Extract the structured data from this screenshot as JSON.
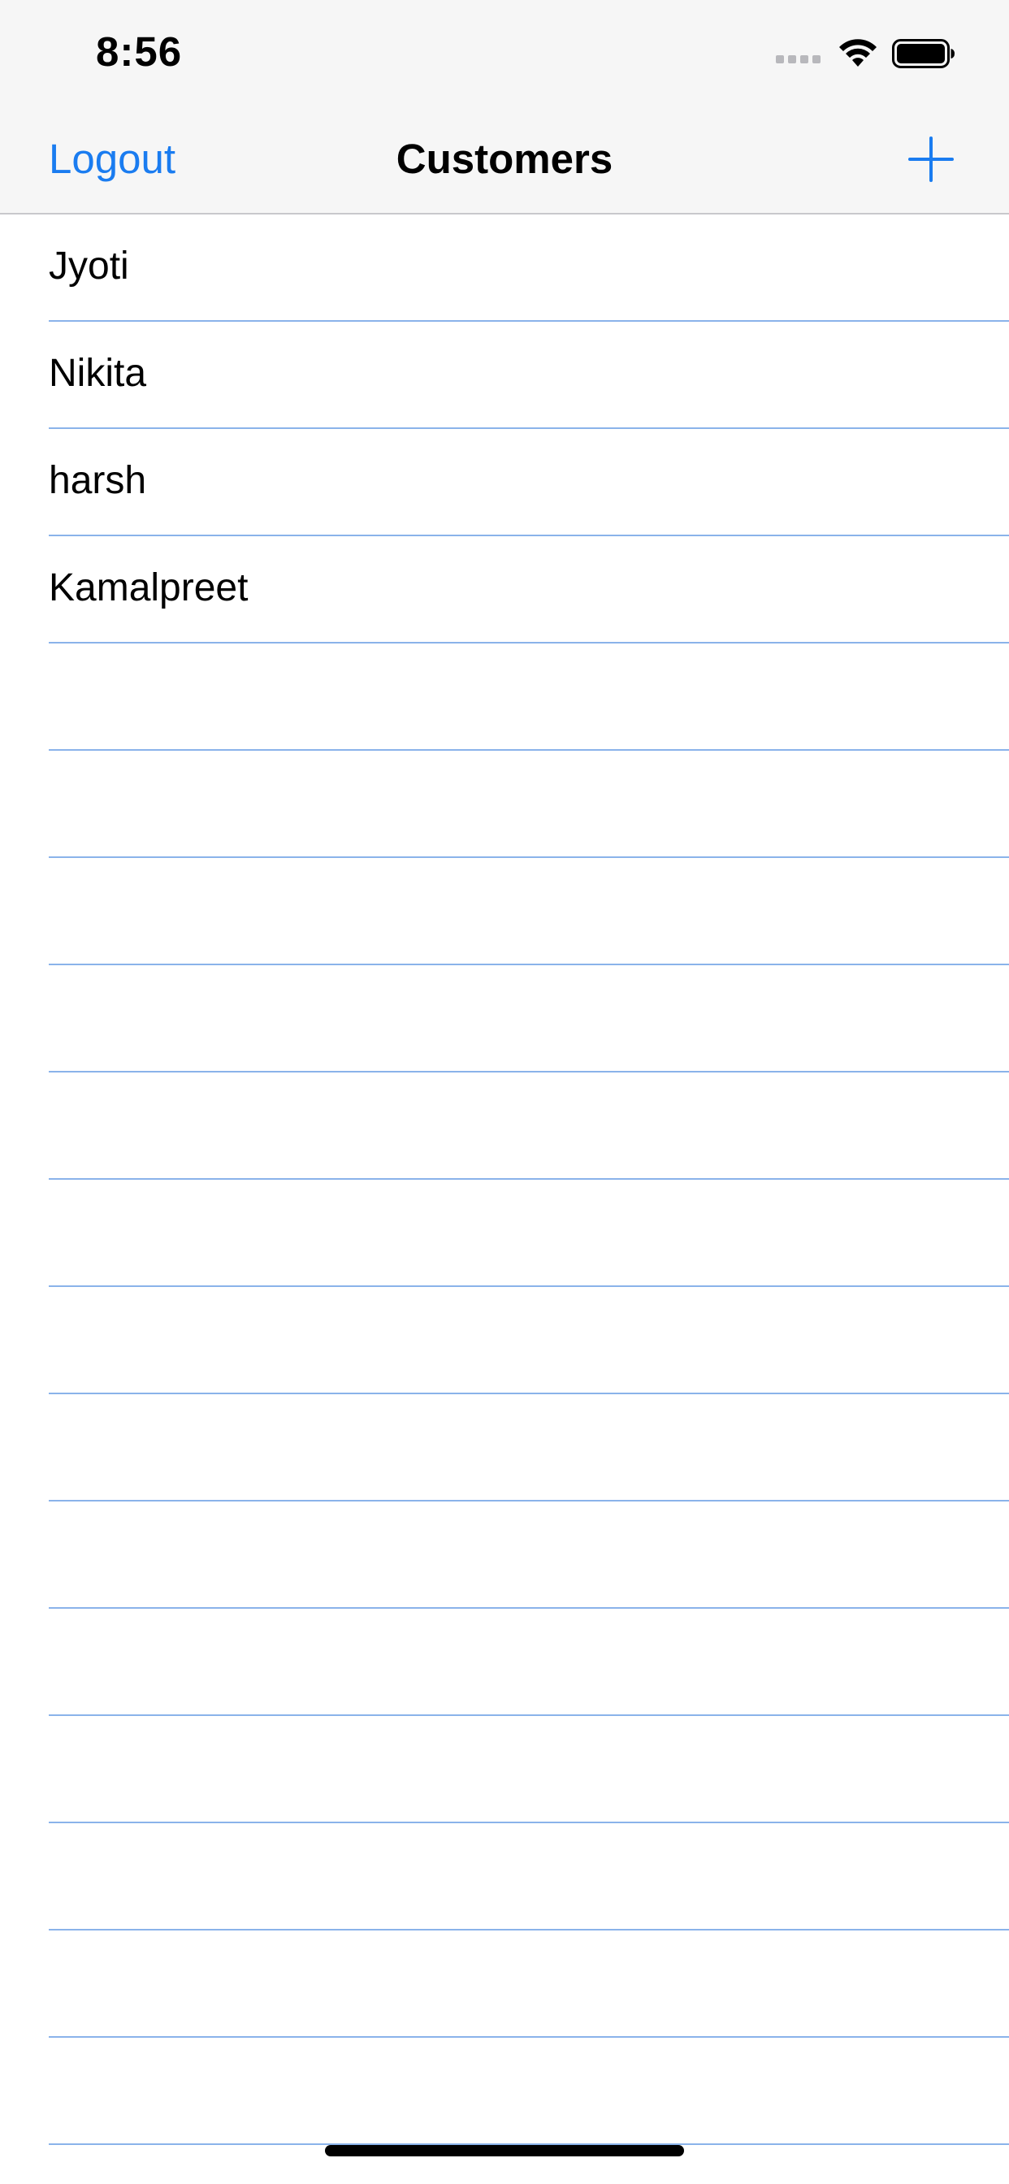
{
  "status_bar": {
    "time": "8:56"
  },
  "nav": {
    "left_button": "Logout",
    "title": "Customers",
    "right_icon": "plus-icon"
  },
  "customers": [
    {
      "name": "Jyoti"
    },
    {
      "name": "Nikita"
    },
    {
      "name": "harsh"
    },
    {
      "name": "Kamalpreet"
    }
  ],
  "empty_rows": 14,
  "colors": {
    "accent": "#1a7cf0",
    "separator": "#8ab3ea",
    "nav_background": "#f6f6f6"
  }
}
